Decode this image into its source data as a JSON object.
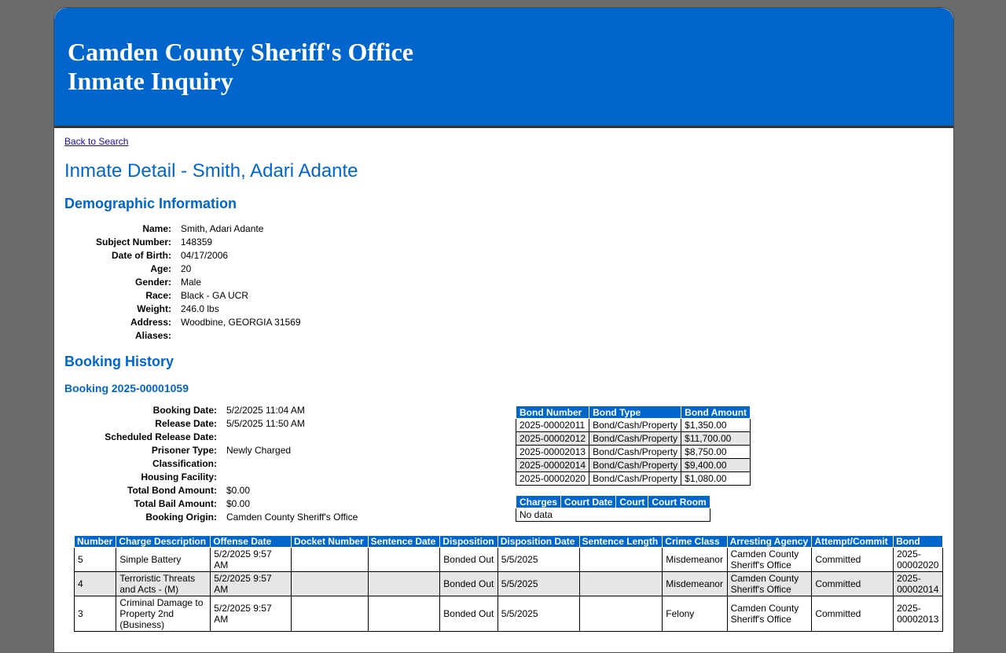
{
  "header": {
    "title_line1": "Camden County Sheriff's Office",
    "title_line2": "Inmate Inquiry"
  },
  "nav": {
    "back_link": "Back to Search"
  },
  "page_title": "Inmate Detail - Smith, Adari Adante",
  "demographics": {
    "heading": "Demographic Information",
    "fields": [
      {
        "label": "Name:",
        "value": "Smith, Adari Adante"
      },
      {
        "label": "Subject Number:",
        "value": "148359"
      },
      {
        "label": "Date of Birth:",
        "value": "04/17/2006"
      },
      {
        "label": "Age:",
        "value": "20"
      },
      {
        "label": "Gender:",
        "value": "Male"
      },
      {
        "label": "Race:",
        "value": "Black - GA UCR"
      },
      {
        "label": "Weight:",
        "value": "246.0 lbs"
      },
      {
        "label": "Address:",
        "value": "Woodbine, GEORGIA 31569"
      },
      {
        "label": "Aliases:",
        "value": ""
      }
    ]
  },
  "booking_history": {
    "heading": "Booking History",
    "booking_title": "Booking 2025-00001059",
    "fields": [
      {
        "label": "Booking Date:",
        "value": "5/2/2025 11:04 AM"
      },
      {
        "label": "Release Date:",
        "value": "5/5/2025 11:50 AM"
      },
      {
        "label": "Scheduled Release Date:",
        "value": ""
      },
      {
        "label": "Prisoner Type:",
        "value": "Newly Charged"
      },
      {
        "label": "Classification:",
        "value": ""
      },
      {
        "label": "Housing Facility:",
        "value": ""
      },
      {
        "label": "Total Bond Amount:",
        "value": "$0.00"
      },
      {
        "label": "Total Bail Amount:",
        "value": "$0.00"
      },
      {
        "label": "Booking Origin:",
        "value": "Camden County Sheriff's Office"
      }
    ],
    "bonds": {
      "headers": [
        "Bond Number",
        "Bond Type",
        "Bond Amount"
      ],
      "rows": [
        [
          "2025-00002011",
          "Bond/Cash/Property",
          "$1,350.00"
        ],
        [
          "2025-00002012",
          "Bond/Cash/Property",
          "$11,700.00"
        ],
        [
          "2025-00002013",
          "Bond/Cash/Property",
          "$8,750.00"
        ],
        [
          "2025-00002014",
          "Bond/Cash/Property",
          "$9,400.00"
        ],
        [
          "2025-00002020",
          "Bond/Cash/Property",
          "$1,080.00"
        ]
      ]
    },
    "court": {
      "headers": [
        "Charges",
        "Court Date",
        "Court",
        "Court Room"
      ],
      "empty_text": "No data"
    },
    "charges": {
      "headers": [
        "Number",
        "Charge Description",
        "Offense Date",
        "Docket Number",
        "Sentence Date",
        "Disposition",
        "Disposition Date",
        "Sentence Length",
        "Crime Class",
        "Arresting Agency",
        "Attempt/Commit",
        "Bond"
      ],
      "rows": [
        [
          "5",
          "Simple Battery",
          "5/2/2025 9:57 AM",
          "",
          "",
          "Bonded Out",
          "5/5/2025",
          "",
          "Misdemeanor",
          "Camden County Sheriff's Office",
          "Committed",
          "2025-00002020"
        ],
        [
          "4",
          "Terroristic Threats and Acts - (M)",
          "5/2/2025 9:57 AM",
          "",
          "",
          "Bonded Out",
          "5/5/2025",
          "",
          "Misdemeanor",
          "Camden County Sheriff's Office",
          "Committed",
          "2025-00002014"
        ],
        [
          "3",
          "Criminal Damage to Property 2nd (Business)",
          "5/2/2025 9:57 AM",
          "",
          "",
          "Bonded Out",
          "5/5/2025",
          "",
          "Felony",
          "Camden County Sheriff's Office",
          "Committed",
          "2025-00002013"
        ]
      ]
    }
  }
}
